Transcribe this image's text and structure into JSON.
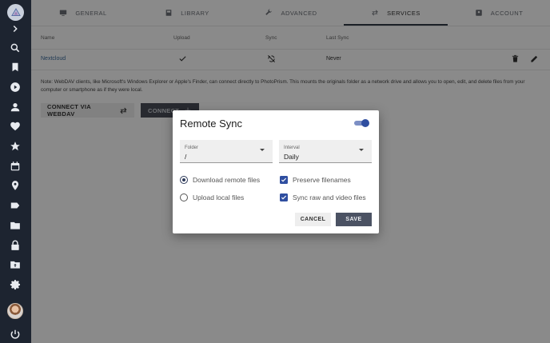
{
  "sidebar": {
    "items": [
      {
        "icon": "chevron-right-icon"
      },
      {
        "icon": "search-icon"
      },
      {
        "icon": "bookmark-icon"
      },
      {
        "icon": "play-icon"
      },
      {
        "icon": "person-icon"
      },
      {
        "icon": "heart-icon"
      },
      {
        "icon": "star-icon"
      },
      {
        "icon": "calendar-icon"
      },
      {
        "icon": "location-pin-icon"
      },
      {
        "icon": "label-icon"
      },
      {
        "icon": "folder-icon"
      },
      {
        "icon": "lock-icon"
      },
      {
        "icon": "folder-upload-icon"
      },
      {
        "icon": "gear-icon"
      },
      {
        "icon": "power-icon"
      }
    ]
  },
  "tabs": [
    {
      "label": "GENERAL",
      "icon": "monitor-icon"
    },
    {
      "label": "LIBRARY",
      "icon": "library-icon"
    },
    {
      "label": "ADVANCED",
      "icon": "wrench-icon"
    },
    {
      "label": "SERVICES",
      "icon": "swap-arrows-icon",
      "active": true
    },
    {
      "label": "ACCOUNT",
      "icon": "account-icon"
    }
  ],
  "table": {
    "headers": {
      "name": "Name",
      "upload": "Upload",
      "sync": "Sync",
      "last_sync": "Last Sync"
    },
    "rows": [
      {
        "name": "Nextcloud",
        "upload": "check-icon",
        "sync": "sync-disabled-icon",
        "last_sync": "Never"
      }
    ]
  },
  "note": "Note: WebDAV clients, like Microsoft's Windows Explorer or Apple's Finder, can connect directly to PhotoPrism. This mounts the originals folder as a network drive and allows you to open, edit, and delete files from your computer or smartphone as if they were local.",
  "buttons": {
    "webdav": "CONNECT VIA WEBDAV",
    "connect": "CONNECT"
  },
  "dialog": {
    "title": "Remote Sync",
    "enabled": true,
    "folder": {
      "label": "Folder",
      "value": "/"
    },
    "interval": {
      "label": "Interval",
      "value": "Daily"
    },
    "radios": [
      {
        "label": "Download remote files",
        "checked": true
      },
      {
        "label": "Upload local files",
        "checked": false
      }
    ],
    "checkboxes": [
      {
        "label": "Preserve filenames",
        "checked": true
      },
      {
        "label": "Sync raw and video files",
        "checked": true
      }
    ],
    "cancel": "CANCEL",
    "save": "SAVE"
  },
  "colors": {
    "sidebar": "#1d2430",
    "accent": "#2f4ea0",
    "primary_button": "#4b5263"
  }
}
